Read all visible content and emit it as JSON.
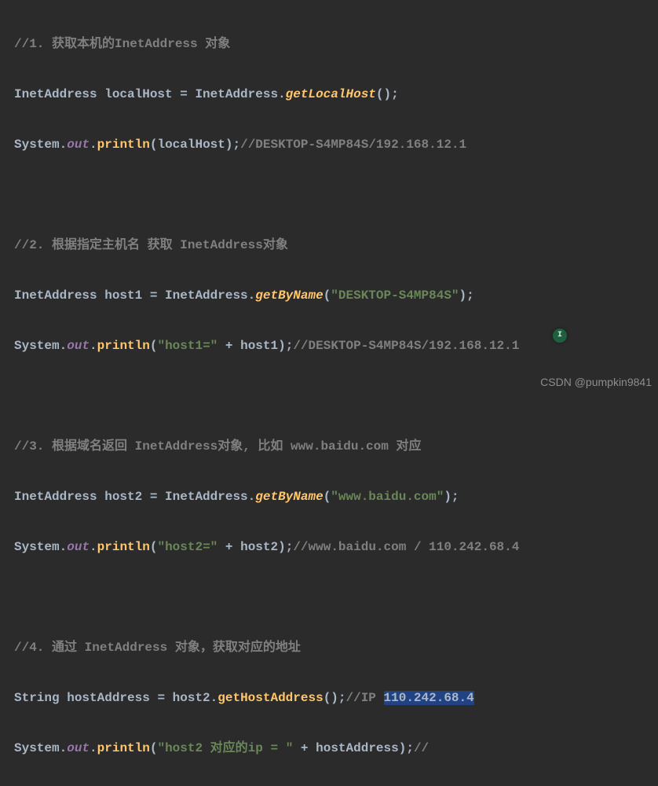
{
  "lines": {
    "l1_comment": "//1. 获取本机的InetAddress 对象",
    "l2_class1": "InetAddress ",
    "l2_var": "localHost ",
    "l2_eq": "= ",
    "l2_class2": "InetAddress",
    "l2_dot": ".",
    "l2_meth": "getLocalHost",
    "l2_call": "();",
    "l3_sys": "System",
    "l3_dot1": ".",
    "l3_out": "out",
    "l3_dot2": ".",
    "l3_print": "println",
    "l3_p1": "(",
    "l3_arg": "localHost",
    "l3_p2": ");",
    "l3_cmt": "//DESKTOP-S4MP84S/192.168.12.1",
    "l5_comment": "//2. 根据指定主机名 获取 InetAddress对象",
    "l6_class1": "InetAddress ",
    "l6_var": "host1 ",
    "l6_eq": "= ",
    "l6_class2": "InetAddress",
    "l6_dot": ".",
    "l6_meth": "getByName",
    "l6_p1": "(",
    "l6_str": "\"DESKTOP-S4MP84S\"",
    "l6_p2": ");",
    "l7_sys": "System",
    "l7_dot1": ".",
    "l7_out": "out",
    "l7_dot2": ".",
    "l7_print": "println",
    "l7_p1": "(",
    "l7_str": "\"host1=\" ",
    "l7_plus": "+ ",
    "l7_arg": "host1",
    "l7_p2": ");",
    "l7_cmt": "//DESKTOP-S4MP84S/192.168.12.1",
    "l9_comment": "//3. 根据域名返回 InetAddress对象, 比如 www.baidu.com 对应",
    "l10_class1": "InetAddress ",
    "l10_var": "host2 ",
    "l10_eq": "= ",
    "l10_class2": "InetAddress",
    "l10_dot": ".",
    "l10_meth": "getByName",
    "l10_p1": "(",
    "l10_str": "\"www.baidu.com\"",
    "l10_p2": ");",
    "l11_sys": "System",
    "l11_dot1": ".",
    "l11_out": "out",
    "l11_dot2": ".",
    "l11_print": "println",
    "l11_p1": "(",
    "l11_str": "\"host2=\" ",
    "l11_plus": "+ ",
    "l11_arg": "host2",
    "l11_p2": ");",
    "l11_cmt": "//www.baidu.com / 110.242.68.4",
    "l13_comment": "//4. 通过 InetAddress 对象，获取对应的地址",
    "l14_class1": "String ",
    "l14_var": "hostAddress ",
    "l14_eq": "= ",
    "l14_obj": "host2",
    "l14_dot": ".",
    "l14_meth": "getHostAddress",
    "l14_call": "();",
    "l14_cmt_a": "//IP ",
    "l14_cmt_b": "110.242.68.4",
    "l15_sys": "System",
    "l15_dot1": ".",
    "l15_out": "out",
    "l15_dot2": ".",
    "l15_print": "println",
    "l15_p1": "(",
    "l15_str": "\"host2 对应的ip = \" ",
    "l15_plus": "+ ",
    "l15_arg": "hostAddress",
    "l15_p2": ");",
    "l15_cmt": "//"
  },
  "watermark": "CSDN @pumpkin9841",
  "caret_icon": "I"
}
